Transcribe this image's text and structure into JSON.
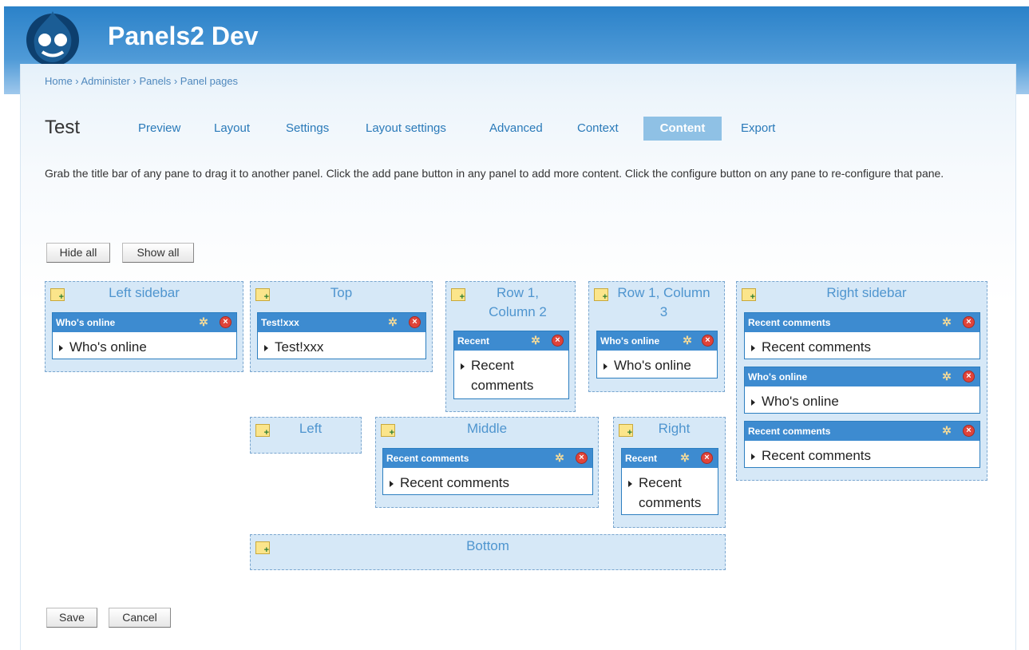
{
  "site": {
    "name": "Panels2 Dev",
    "logo_icon": "drupal-drop-logo"
  },
  "breadcrumb": "Home › Administer › Panels › Panel pages",
  "page_title": "Test",
  "tabs": [
    {
      "label": "Preview",
      "active": false
    },
    {
      "label": "Layout",
      "active": false
    },
    {
      "label": "Settings",
      "active": false
    },
    {
      "label": "Layout settings",
      "active": false
    },
    {
      "label": "Advanced",
      "active": false
    },
    {
      "label": "Context",
      "active": false
    },
    {
      "label": "Content",
      "active": true
    },
    {
      "label": "Export",
      "active": false
    }
  ],
  "help_text": "Grab the title bar of any pane to drag it to another panel. Click the add pane button in any panel to add more content. Click the configure button on any pane to re-configure that pane.",
  "buttons": {
    "hide_all": "Hide all",
    "show_all": "Show all",
    "save": "Save",
    "cancel": "Cancel"
  },
  "panels": {
    "left_sidebar": {
      "title": "Left sidebar",
      "panes": [
        {
          "bar": "Who's online",
          "body": "Who's online"
        }
      ]
    },
    "top": {
      "title": "Top",
      "panes": [
        {
          "bar": "Test!xxx",
          "body": "Test!xxx"
        }
      ]
    },
    "row1_col2": {
      "title": "Row 1, Column 2",
      "panes": [
        {
          "bar": "Recent",
          "body": "Recent comments"
        }
      ]
    },
    "row1_col3": {
      "title": "Row 1, Column 3",
      "panes": [
        {
          "bar": "Who's online",
          "body": "Who's online"
        }
      ]
    },
    "right_sidebar": {
      "title": "Right sidebar",
      "panes": [
        {
          "bar": "Recent comments",
          "body": "Recent comments"
        },
        {
          "bar": "Who's online",
          "body": "Who's online"
        },
        {
          "bar": "Recent comments",
          "body": "Recent comments"
        }
      ]
    },
    "left": {
      "title": "Left",
      "panes": []
    },
    "middle": {
      "title": "Middle",
      "panes": [
        {
          "bar": "Recent comments",
          "body": "Recent comments"
        }
      ]
    },
    "right": {
      "title": "Right",
      "panes": [
        {
          "bar": "Recent",
          "body": "Recent comments"
        }
      ]
    },
    "bottom": {
      "title": "Bottom",
      "panes": []
    }
  },
  "icons": {
    "add": "add-content-icon",
    "configure": "gear-icon",
    "delete": "delete-icon",
    "expand": "triangle-right-icon"
  },
  "colors": {
    "header": "#2b82c9",
    "pane_bar": "#3d8bd0",
    "panel_bg": "#d6e8f7",
    "active_tab": "#8fc1e5"
  }
}
